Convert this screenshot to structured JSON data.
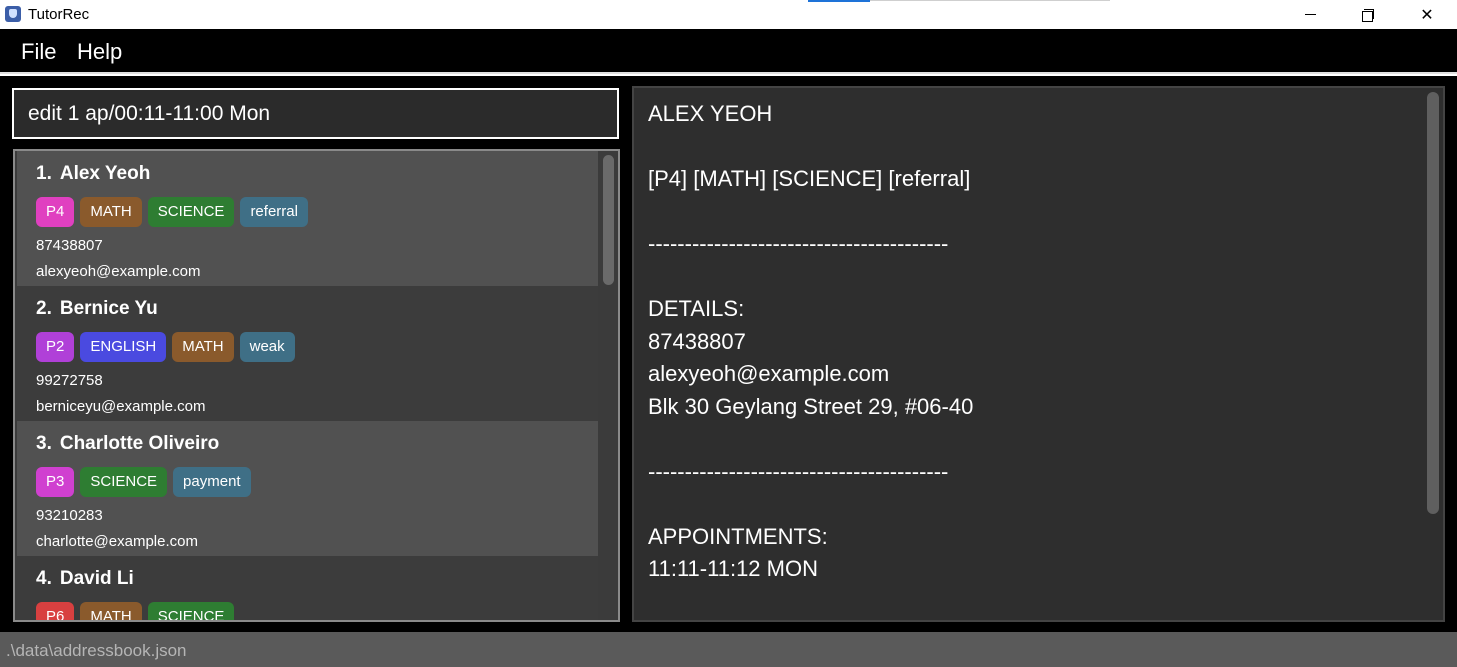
{
  "window": {
    "title": "TutorRec"
  },
  "menu": {
    "file": "File",
    "help": "Help"
  },
  "command": {
    "value": "edit 1 ap/00:11-11:00 Mon"
  },
  "persons": [
    {
      "index": "1.",
      "name": "Alex Yeoh",
      "tags": [
        {
          "label": "P4",
          "color": "#e040c0"
        },
        {
          "label": "MATH",
          "color": "#8a5a2c"
        },
        {
          "label": "SCIENCE",
          "color": "#2e7d32"
        },
        {
          "label": "referral",
          "color": "#3f6f86"
        }
      ],
      "phone": "87438807",
      "email": "alexyeoh@example.com"
    },
    {
      "index": "2.",
      "name": "Bernice Yu",
      "tags": [
        {
          "label": "P2",
          "color": "#b040d8"
        },
        {
          "label": "ENGLISH",
          "color": "#4a4ae0"
        },
        {
          "label": "MATH",
          "color": "#8a5a2c"
        },
        {
          "label": "weak",
          "color": "#3f6f86"
        }
      ],
      "phone": "99272758",
      "email": "berniceyu@example.com"
    },
    {
      "index": "3.",
      "name": "Charlotte Oliveiro",
      "tags": [
        {
          "label": "P3",
          "color": "#d040d0"
        },
        {
          "label": "SCIENCE",
          "color": "#2e7d32"
        },
        {
          "label": "payment",
          "color": "#3f6f86"
        }
      ],
      "phone": "93210283",
      "email": "charlotte@example.com"
    },
    {
      "index": "4.",
      "name": "David Li",
      "tags": [
        {
          "label": "P6",
          "color": "#d84040"
        },
        {
          "label": "MATH",
          "color": "#8a5a2c"
        },
        {
          "label": "SCIENCE",
          "color": "#2e7d32"
        }
      ],
      "phone": "",
      "email": ""
    }
  ],
  "detail": {
    "name": "ALEX YEOH",
    "tags_line": "[P4] [MATH] [SCIENCE] [referral]",
    "divider": "-----------------------------------------",
    "details_header": "DETAILS:",
    "phone": "87438807",
    "email": "alexyeoh@example.com",
    "address": "Blk 30 Geylang Street 29, #06-40",
    "appointments_header": "APPOINTMENTS:",
    "appointment": "11:11-11:12 MON"
  },
  "status": {
    "path": ".\\data\\addressbook.json"
  }
}
